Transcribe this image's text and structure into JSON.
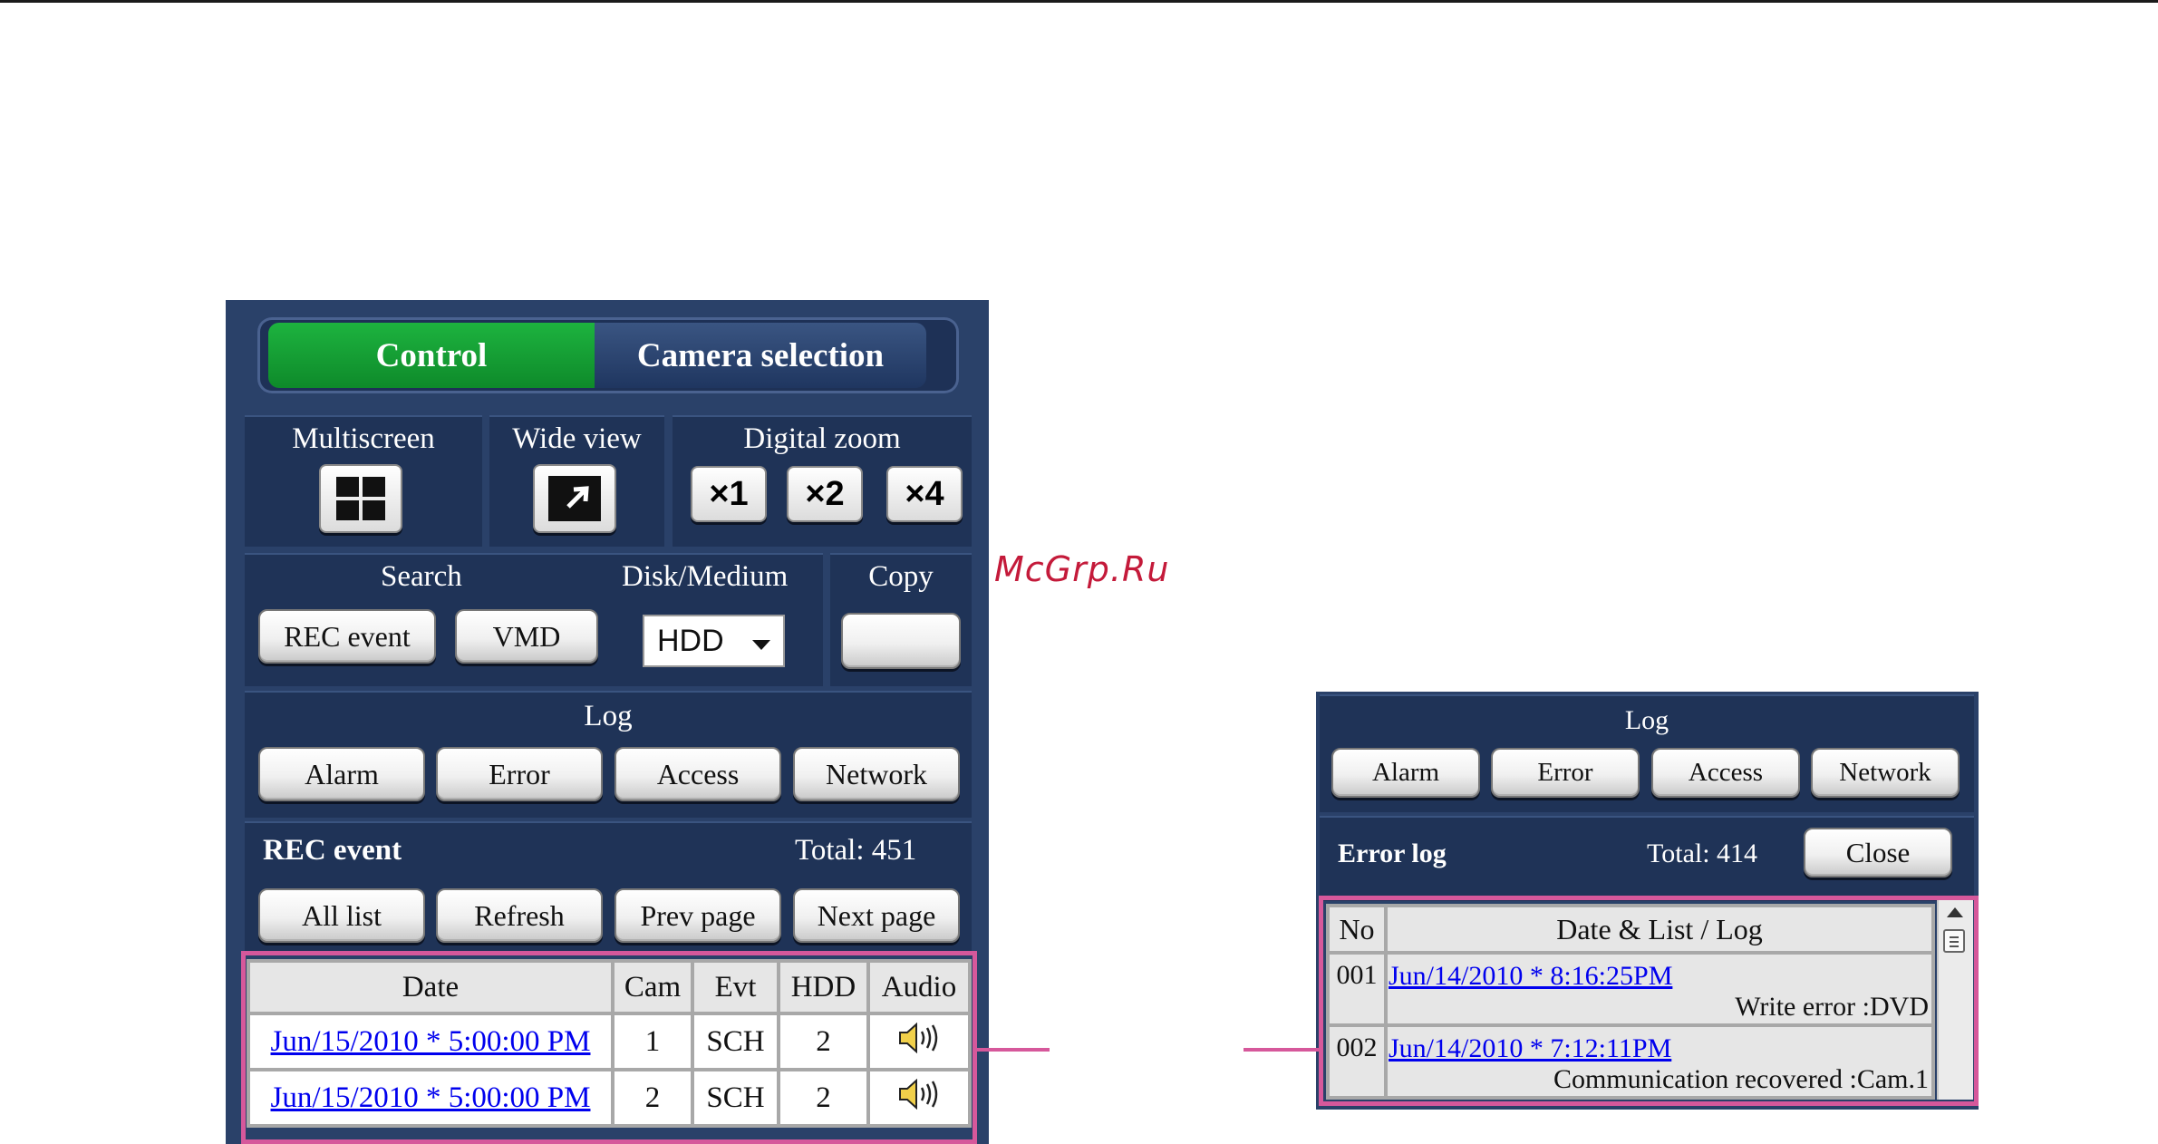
{
  "watermark": "McGrp.Ru",
  "tabs": {
    "control": "Control",
    "camera_selection": "Camera selection"
  },
  "multiscreen": {
    "label": "Multiscreen",
    "icon": "quad-grid-icon"
  },
  "wide_view": {
    "label": "Wide view",
    "icon": "expand-arrow-icon"
  },
  "digital_zoom": {
    "label": "Digital zoom",
    "buttons": [
      "×1",
      "×2",
      "×4"
    ]
  },
  "search": {
    "label": "Search",
    "buttons": [
      "REC event",
      "VMD"
    ]
  },
  "disk": {
    "label": "Disk/Medium",
    "selected": "HDD"
  },
  "copy": {
    "label": "Copy",
    "button": ""
  },
  "log": {
    "label": "Log",
    "buttons": [
      "Alarm",
      "Error",
      "Access",
      "Network"
    ]
  },
  "rec_event": {
    "title": "REC event",
    "total": "Total: 451",
    "buttons": [
      "All list",
      "Refresh",
      "Prev page",
      "Next page"
    ],
    "columns": [
      "Date",
      "Cam",
      "Evt",
      "HDD",
      "Audio"
    ],
    "rows": [
      {
        "date": "Jun/15/2010   * 5:00:00 PM",
        "cam": "1",
        "evt": "SCH",
        "hdd": "2",
        "audio_icon": "speaker-icon"
      },
      {
        "date": "Jun/15/2010   * 5:00:00 PM",
        "cam": "2",
        "evt": "SCH",
        "hdd": "2",
        "audio_icon": "speaker-icon"
      }
    ]
  },
  "error_panel": {
    "log_label": "Log",
    "log_buttons": [
      "Alarm",
      "Error",
      "Access",
      "Network"
    ],
    "title": "Error log",
    "total": "Total: 414",
    "close": "Close",
    "columns": [
      "No",
      "Date & List / Log"
    ],
    "rows": [
      {
        "no": "001",
        "date": "Jun/14/2010  * 8:16:25PM",
        "message": "Write error :DVD"
      },
      {
        "no": "002",
        "date": "Jun/14/2010  * 7:12:11PM",
        "message": "Communication recovered :Cam.1"
      }
    ]
  },
  "colors": {
    "panel": "#2a4169",
    "active_tab": "#129c35",
    "highlight": "#d6589b",
    "link": "#0000ee"
  }
}
